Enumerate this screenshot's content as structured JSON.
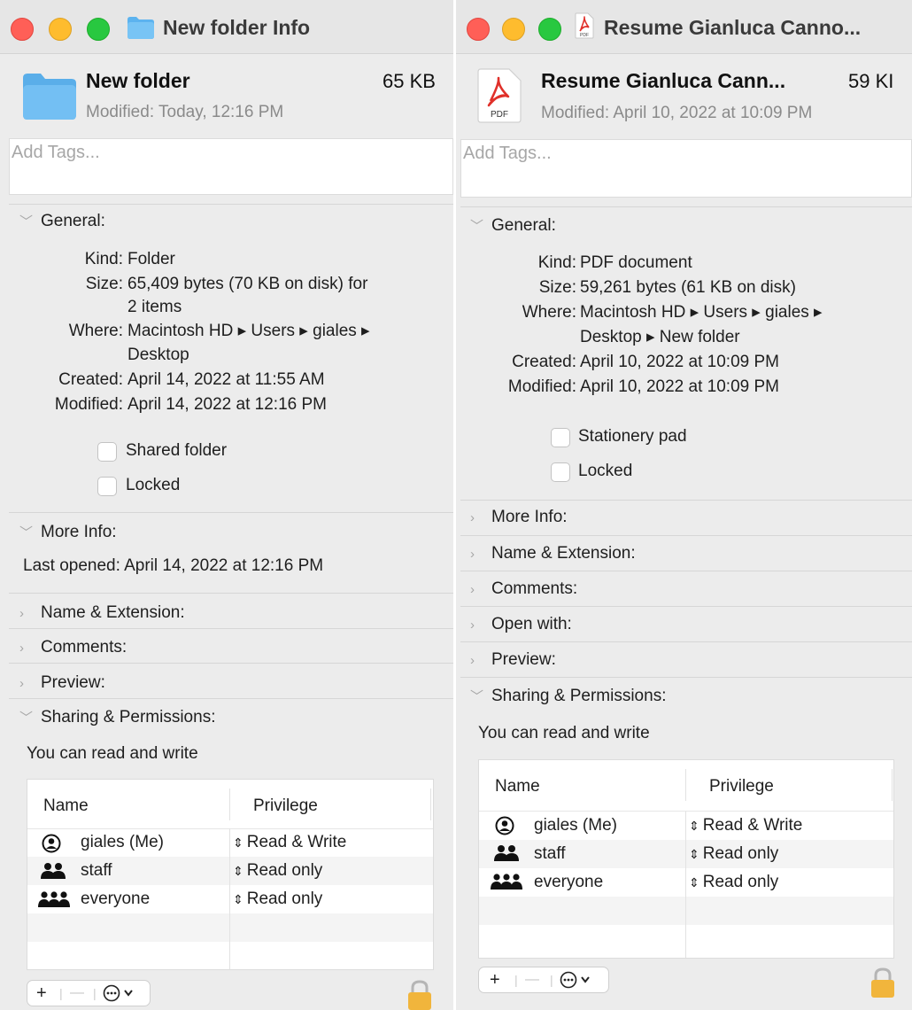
{
  "window1": {
    "title": "New folder Info",
    "name": "New folder",
    "size": "65 KB",
    "modified": "Modified: Today, 12:16 PM",
    "tags_placeholder": "Add Tags...",
    "general": {
      "header": "General:",
      "rows": [
        {
          "key": "Kind:",
          "value": "Folder"
        },
        {
          "key": "Size:",
          "value": "65,409 bytes (70 KB on disk) for",
          "cont": "2 items"
        },
        {
          "key": "Where:",
          "value": "Macintosh HD ▸ Users ▸ giales ▸",
          "cont": "Desktop"
        },
        {
          "key": "Created:",
          "value": "April 14, 2022 at 11:55 AM"
        },
        {
          "key": "Modified:",
          "value": "April 14, 2022 at 12:16 PM"
        }
      ],
      "checkboxes": [
        {
          "label": "Shared folder",
          "checked": false
        },
        {
          "label": "Locked",
          "checked": false
        }
      ]
    },
    "more_info": {
      "header": "More Info:",
      "last_opened": "Last opened: April 14, 2022 at 12:16 PM"
    },
    "collapsed_sections": [
      "Name & Extension:",
      "Comments:",
      "Preview:"
    ],
    "sharing": {
      "header": "Sharing & Permissions:",
      "status": "You can read and write",
      "col_name": "Name",
      "col_privilege": "Privilege",
      "rows": [
        {
          "name": "giales (Me)",
          "privilege": "Read & Write",
          "icon": "user-icon"
        },
        {
          "name": "staff",
          "privilege": "Read only",
          "icon": "group-icon"
        },
        {
          "name": "everyone",
          "privilege": "Read only",
          "icon": "everyone-icon"
        }
      ]
    },
    "buttons": {
      "add": "+",
      "remove": "—",
      "action": "⋯"
    }
  },
  "window2": {
    "title": "Resume Gianluca Canno...",
    "name": "Resume Gianluca Cann...",
    "size": "59 KI",
    "modified": "Modified: April 10, 2022 at 10:09 PM",
    "pdf_badge": "PDF",
    "tags_placeholder": "Add Tags...",
    "general": {
      "header": "General:",
      "rows": [
        {
          "key": "Kind:",
          "value": "PDF document"
        },
        {
          "key": "Size:",
          "value": "59,261 bytes (61 KB on disk)"
        },
        {
          "key": "Where:",
          "value": "Macintosh HD ▸ Users ▸ giales ▸",
          "cont": "Desktop ▸ New folder"
        },
        {
          "key": "Created:",
          "value": "April 10, 2022 at 10:09 PM"
        },
        {
          "key": "Modified:",
          "value": "April 10, 2022 at 10:09 PM"
        }
      ],
      "checkboxes": [
        {
          "label": "Stationery pad",
          "checked": false
        },
        {
          "label": "Locked",
          "checked": false
        }
      ]
    },
    "collapsed_sections": [
      "More Info:",
      "Name & Extension:",
      "Comments:",
      "Open with:",
      "Preview:"
    ],
    "sharing": {
      "header": "Sharing & Permissions:",
      "status": "You can read and write",
      "col_name": "Name",
      "col_privilege": "Privilege",
      "rows": [
        {
          "name": "giales (Me)",
          "privilege": "Read & Write",
          "icon": "user-icon"
        },
        {
          "name": "staff",
          "privilege": "Read only",
          "icon": "group-icon"
        },
        {
          "name": "everyone",
          "privilege": "Read only",
          "icon": "everyone-icon"
        }
      ]
    },
    "buttons": {
      "add": "+",
      "remove": "—",
      "action": "⋯"
    }
  },
  "symbols": {
    "updown": "⇕",
    "chevron_open": "﹀",
    "chevron_closed": "›"
  },
  "colors": {
    "close": "#ff5f57",
    "minimize": "#febc2e",
    "zoom": "#28c840",
    "folder": "#5cb3ef",
    "pdf": "#e0302a"
  }
}
